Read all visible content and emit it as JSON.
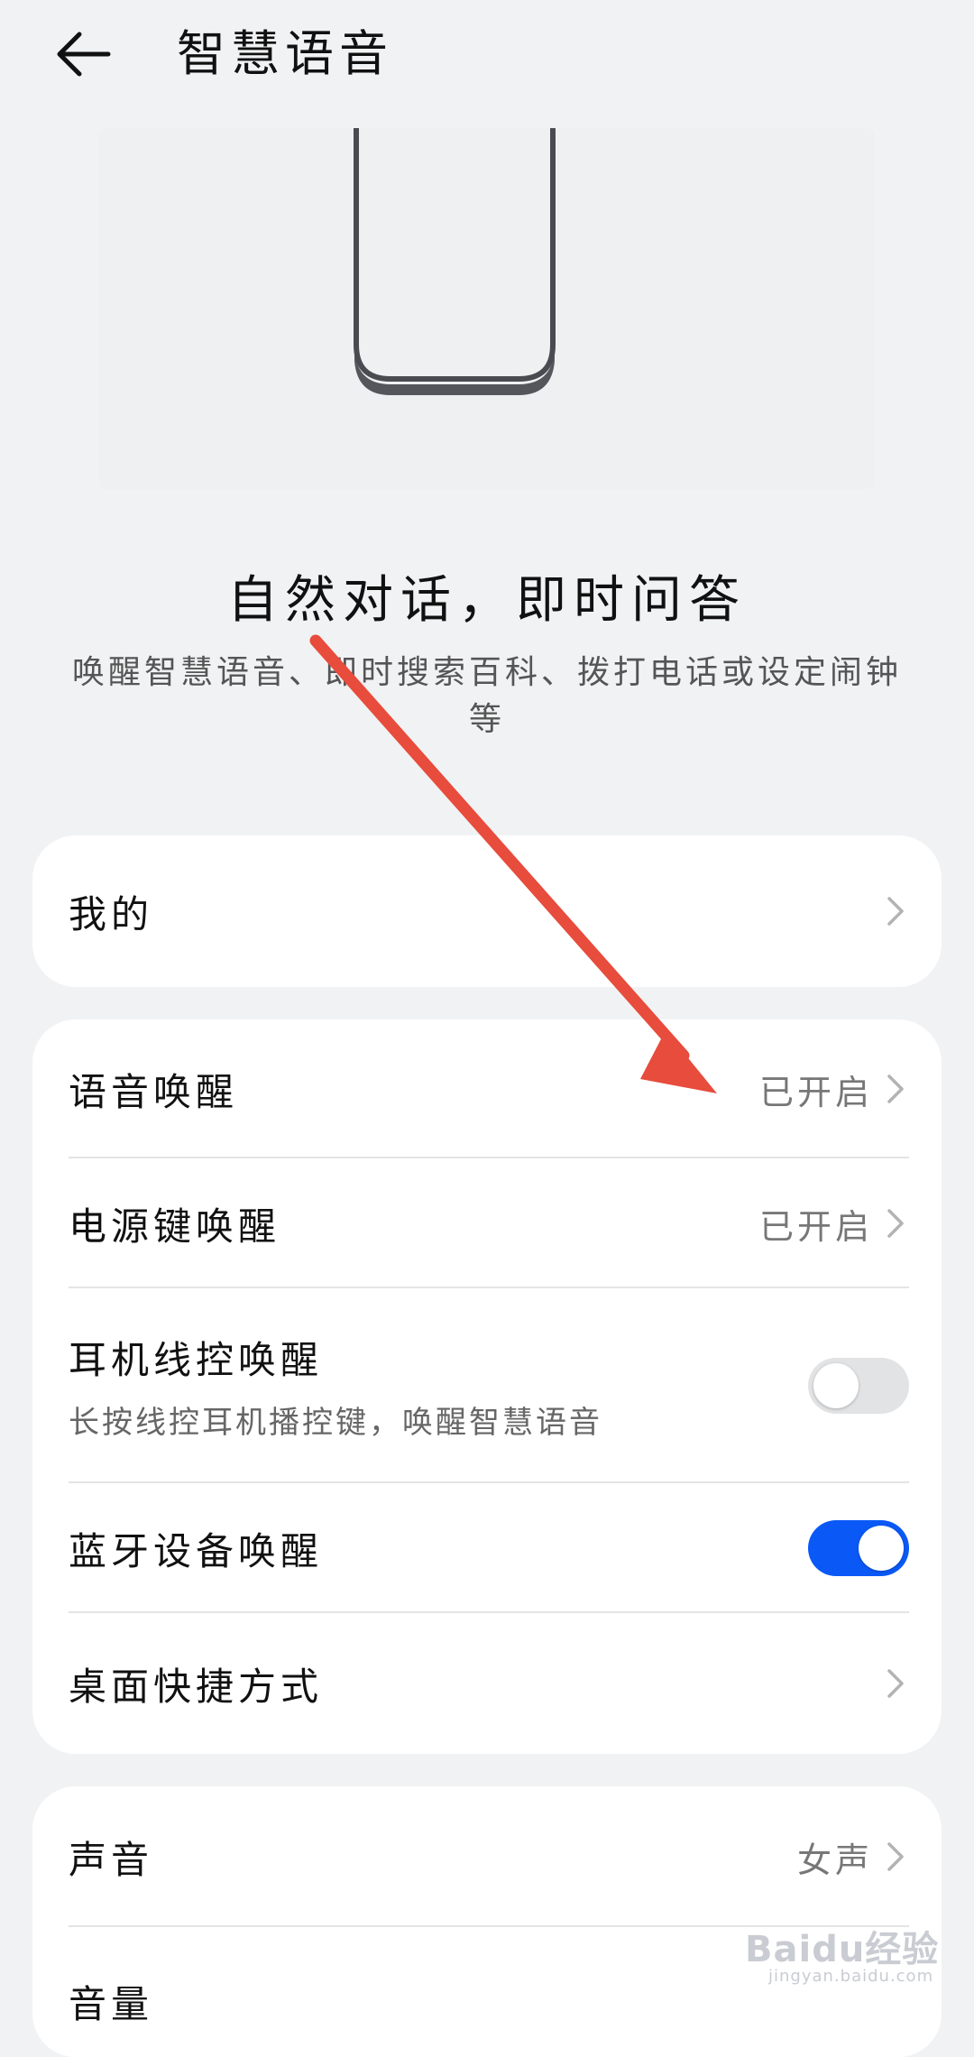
{
  "header": {
    "title": "智慧语音"
  },
  "intro": {
    "headline": "自然对话，即时问答",
    "description": "唤醒智慧语音、即时搜索百科、拨打电话或设定闹钟等"
  },
  "cards": {
    "mine": {
      "label": "我的"
    },
    "wake": {
      "voice_wake": {
        "label": "语音唤醒",
        "value": "已开启"
      },
      "power_key_wake": {
        "label": "电源键唤醒",
        "value": "已开启"
      },
      "wired_headset_wake": {
        "label": "耳机线控唤醒",
        "sublabel": "长按线控耳机播控键，唤醒智慧语音",
        "toggle_on": false
      },
      "bluetooth_wake": {
        "label": "蓝牙设备唤醒",
        "toggle_on": true
      },
      "desktop_shortcut": {
        "label": "桌面快捷方式"
      }
    },
    "sound": {
      "voice": {
        "label": "声音",
        "value": "女声"
      },
      "volume": {
        "label": "音量"
      }
    }
  },
  "watermark": {
    "text": "Baidu经验",
    "sub": "jingyan.baidu.com"
  },
  "colors": {
    "background": "#f1f2f4",
    "card": "#ffffff",
    "toggle_on": "#0a59f7",
    "toggle_off": "#e2e3e5",
    "annotation_arrow": "#e74c3c"
  }
}
